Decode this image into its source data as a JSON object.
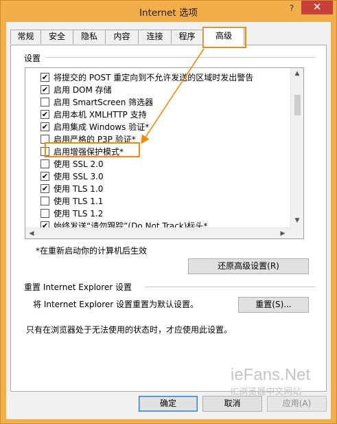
{
  "window": {
    "title": "Internet 选项",
    "help_glyph": "?",
    "close_glyph": "✕"
  },
  "tabs": [
    {
      "label": "常规"
    },
    {
      "label": "安全"
    },
    {
      "label": "隐私"
    },
    {
      "label": "内容"
    },
    {
      "label": "连接"
    },
    {
      "label": "程序"
    },
    {
      "label": "高级",
      "active": true
    }
  ],
  "settings": {
    "group_label": "设置",
    "items": [
      {
        "label": "将提交的 POST 重定向到不允许发送的区域时发出警告",
        "checked": true
      },
      {
        "label": "启用 DOM 存储",
        "checked": true
      },
      {
        "label": "启用 SmartScreen 筛选器",
        "checked": false
      },
      {
        "label": "启用本机 XMLHTTP 支持",
        "checked": true
      },
      {
        "label": "启用集成 Windows 验证*",
        "checked": true
      },
      {
        "label": "启用严格的 P3P 验证*",
        "checked": false
      },
      {
        "label": "启用增强保护模式*",
        "checked": false
      },
      {
        "label": "使用 SSL 2.0",
        "checked": false
      },
      {
        "label": "使用 SSL 3.0",
        "checked": true
      },
      {
        "label": "使用 TLS 1.0",
        "checked": true
      },
      {
        "label": "使用 TLS 1.1",
        "checked": false
      },
      {
        "label": "使用 TLS 1.2",
        "checked": false
      },
      {
        "label": "始终发送“请勿跟踪”(Do Not Track)标头*",
        "checked": true
      }
    ],
    "check_glyph": "✔",
    "scroll_up": "▲",
    "scroll_down": "▼",
    "scroll_left": "◀",
    "scroll_right": "▶",
    "restart_note": "*在重新启动你的计算机后生效",
    "restore_button": "还原高级设置(R)"
  },
  "reset": {
    "group_label": "重置 Internet Explorer 设置",
    "description": "将 Internet Explorer 设置重置为默认设置。",
    "reset_button": "重置(S)...",
    "warning": "只有在浏览器处于无法使用的状态时，才应使用此设置。"
  },
  "footer": {
    "ok": "确定",
    "cancel": "取消",
    "apply": "应用(A)"
  },
  "watermark": {
    "brand": "ieFans.Net",
    "subtitle": "IE浏览器中文网站"
  },
  "colors": {
    "annotation": "#f08a00",
    "close": "#c7413a",
    "frame": "#f2ae4b"
  }
}
